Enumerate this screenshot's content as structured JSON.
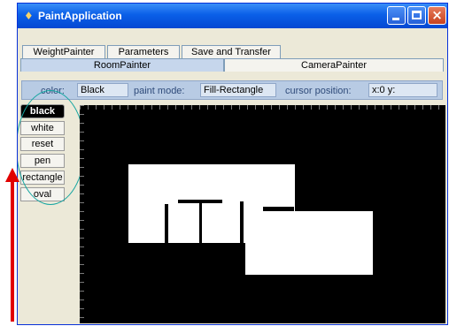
{
  "window": {
    "title": "PaintApplication"
  },
  "tabs": {
    "row1": [
      "WeightPainter",
      "Parameters",
      "Save and Transfer"
    ],
    "row2": [
      "RoomPainter",
      "CameraPainter"
    ],
    "selected": "RoomPainter"
  },
  "toolbar": {
    "color_label": "color:",
    "color_value": "Black",
    "mode_label": "paint mode:",
    "mode_value": "Fill-Rectangle",
    "cursor_label": "cursor position:",
    "cursor_value": "x:0  y:"
  },
  "tools": [
    "black",
    "white",
    "reset",
    "pen",
    "rectangle",
    "oval"
  ],
  "active_tool": "black",
  "icons": [
    "app-icon",
    "minimize-icon",
    "maximize-icon",
    "close-icon"
  ],
  "colors": {
    "titlebar": "#0a5fe8",
    "canvas": "#000000",
    "highlight": "#14a5a0",
    "arrow": "#e10000"
  }
}
